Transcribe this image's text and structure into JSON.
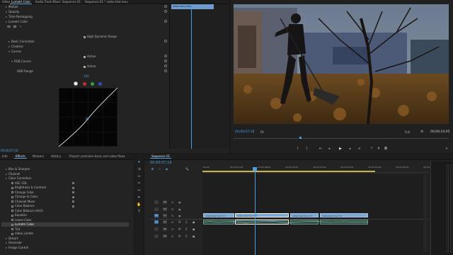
{
  "effect_controls": {
    "tabs": [
      "Video",
      "Lumetri Color",
      "Audio Track Mixer: Sequence 01",
      "Sequence 01 * video-fast.mov"
    ],
    "clip_tab": "video-fast.mov",
    "rows": [
      {
        "label": "Motion",
        "indent": 1
      },
      {
        "label": "Opacity",
        "indent": 1
      },
      {
        "label": "Time Remapping",
        "indent": 1
      },
      {
        "label": "Lumetri Color",
        "indent": 1
      },
      {
        "label": "High Dynamic Range",
        "indent": 3
      },
      {
        "label": "Basic Correction",
        "indent": 2
      },
      {
        "label": "Creative",
        "indent": 2
      },
      {
        "label": "Curves",
        "indent": 2
      },
      {
        "label": "Active",
        "indent": 3
      },
      {
        "label": "RGB Curves",
        "indent": 3
      },
      {
        "label": "Active",
        "indent": 3
      },
      {
        "label": "HDR Range",
        "indent": 3
      },
      {
        "label": "100",
        "indent": 6
      }
    ],
    "timecode": "00;00;07;18",
    "curve_colors": [
      "#ffffff",
      "#d43a3a",
      "#3ab04a",
      "#3a5fd4"
    ]
  },
  "program": {
    "timecode_left": "00;00;07;18",
    "fit": "Fit",
    "quality": "Full",
    "timecode_right": "00;00;24;05"
  },
  "effects_panel": {
    "tabs": [
      "Info",
      "Effects",
      "Markers",
      "History",
      "Project: premiere basic and video flows"
    ],
    "items": [
      {
        "label": "Blur & Sharpen",
        "level": 1
      },
      {
        "label": "Channel",
        "level": 1
      },
      {
        "label": "Color Correction",
        "level": 1
      },
      {
        "label": "ASC CDL",
        "level": 2
      },
      {
        "label": "Brightness & Contrast",
        "level": 2
      },
      {
        "label": "Change Color",
        "level": 2
      },
      {
        "label": "Change to Color",
        "level": 2
      },
      {
        "label": "Channel Mixer",
        "level": 2
      },
      {
        "label": "Color Balance",
        "level": 2
      },
      {
        "label": "Color Balance (HLS)",
        "level": 2
      },
      {
        "label": "Equalize",
        "level": 2
      },
      {
        "label": "Leave Color",
        "level": 2
      },
      {
        "label": "Lumetri Color",
        "level": 2,
        "selected": true
      },
      {
        "label": "Tint",
        "level": 2
      },
      {
        "label": "Video Limiter",
        "level": 2
      },
      {
        "label": "Distort",
        "level": 1
      },
      {
        "label": "Generate",
        "level": 1
      },
      {
        "label": "Image Control",
        "level": 1
      }
    ]
  },
  "timeline": {
    "tab": "Sequence 01",
    "timecode": "00;00;07;18",
    "ruler": [
      ":00;00",
      "00;00;04;00",
      "00;00;08;00",
      "00;00;12;00",
      "00;00;16;00",
      "00;00;20;00",
      "00;00;24;00",
      "00;00;28;00",
      "00;00;32;00"
    ],
    "video_tracks": [
      "V3",
      "V2",
      "V1"
    ],
    "audio_tracks": [
      "A1",
      "A2",
      "A3"
    ],
    "clips": [
      {
        "label": "video-fast.mov [V]"
      },
      {
        "label": "video-fast.mov [V]"
      },
      {
        "label": "video-fast.mov [V]"
      },
      {
        "label": "video-fast.mov [V]"
      }
    ]
  },
  "colors": {
    "accent": "#4a9ee0",
    "clip": "#7aa7d6",
    "audio": "#2f4f46"
  }
}
